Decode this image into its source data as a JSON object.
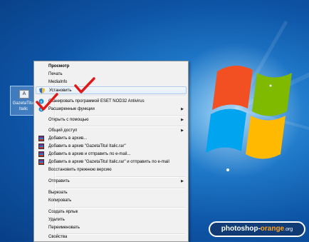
{
  "desktop": {
    "icon_label": "GazetaTitul Italic"
  },
  "context_menu": {
    "items": [
      {
        "label": "Просмотр",
        "bold": true
      },
      {
        "label": "Печать"
      },
      {
        "label": "MediaInfo"
      },
      {
        "label": "Установить",
        "icon": "shield-icon",
        "highlighted": true
      },
      {
        "label": "Сканировать программой ESET NOD32 Antivirus",
        "icon": "eset-icon"
      },
      {
        "label": "Расширенные функции",
        "icon": "eset-icon",
        "submenu": true
      },
      {
        "label": "Открыть с помощью",
        "submenu": true
      },
      {
        "label": "Общий доступ",
        "submenu": true
      },
      {
        "label": "Добавить в архив...",
        "icon": "winrar-icon"
      },
      {
        "label": "Добавить в архив \"GazetaTitul Italic.rar\"",
        "icon": "winrar-icon"
      },
      {
        "label": "Добавить в архив и отправить по e-mail...",
        "icon": "winrar-icon"
      },
      {
        "label": "Добавить в архив \"GazetaTitul Italic.rar\" и отправить по e-mail",
        "icon": "winrar-icon"
      },
      {
        "label": "Восстановить прежнюю версию"
      },
      {
        "label": "Отправить",
        "submenu": true
      },
      {
        "label": "Вырезать"
      },
      {
        "label": "Копировать"
      },
      {
        "label": "Создать ярлык"
      },
      {
        "label": "Удалить"
      },
      {
        "label": "Переименовать"
      },
      {
        "label": "Свойства"
      }
    ]
  },
  "watermark": {
    "part1": "photoshop-",
    "part2": "orange",
    "part3": ".org"
  },
  "colors": {
    "annotation_check": "#e01818",
    "logo_red": "#f25022",
    "logo_green": "#7fba00",
    "logo_blue": "#00a4ef",
    "logo_yellow": "#ffb900"
  }
}
